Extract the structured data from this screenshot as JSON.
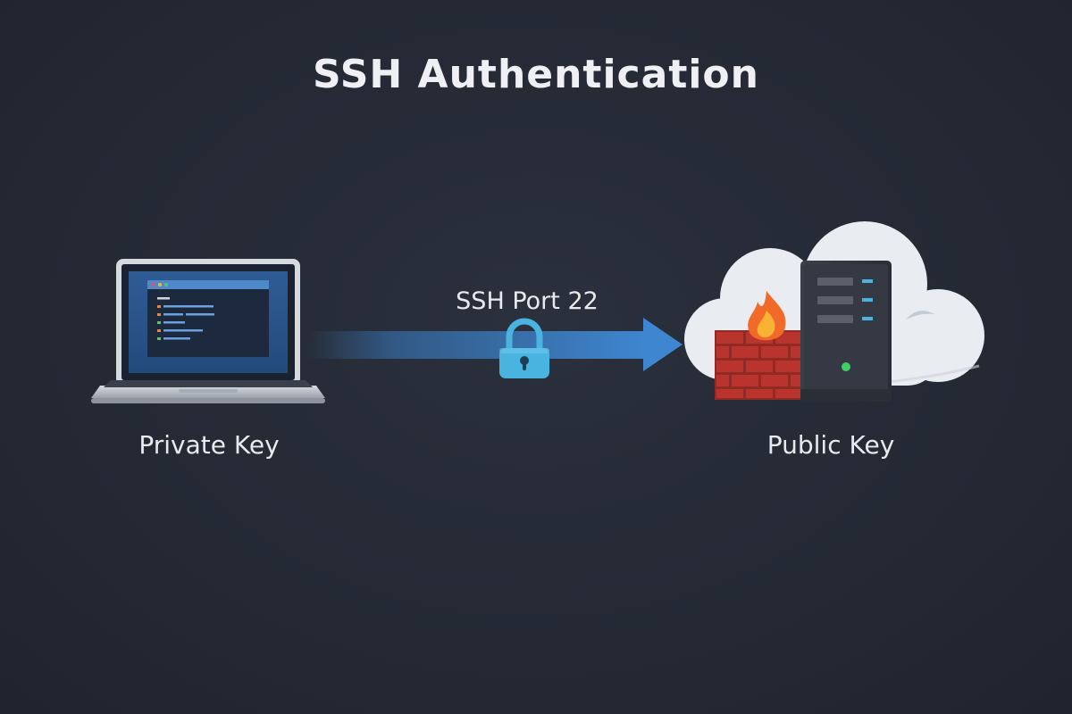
{
  "diagram": {
    "title": "SSH Authentication",
    "client_label": "Private Key",
    "server_label": "Public Key",
    "connection_label": "SSH Port 22"
  },
  "icons": {
    "client": "laptop-icon",
    "connection": "arrow-icon",
    "security": "padlock-icon",
    "server": "server-icon",
    "firewall": "firewall-icon",
    "cloud": "cloud-icon"
  },
  "colors": {
    "background": "#252a35",
    "arrow": "#3b7fc6",
    "padlock": "#49b4e0",
    "firewall": "#b8342d",
    "flame": "#f26a2a",
    "server": "#2f343d",
    "cloud": "#e9ecf1",
    "status_led": "#3fce6a"
  }
}
